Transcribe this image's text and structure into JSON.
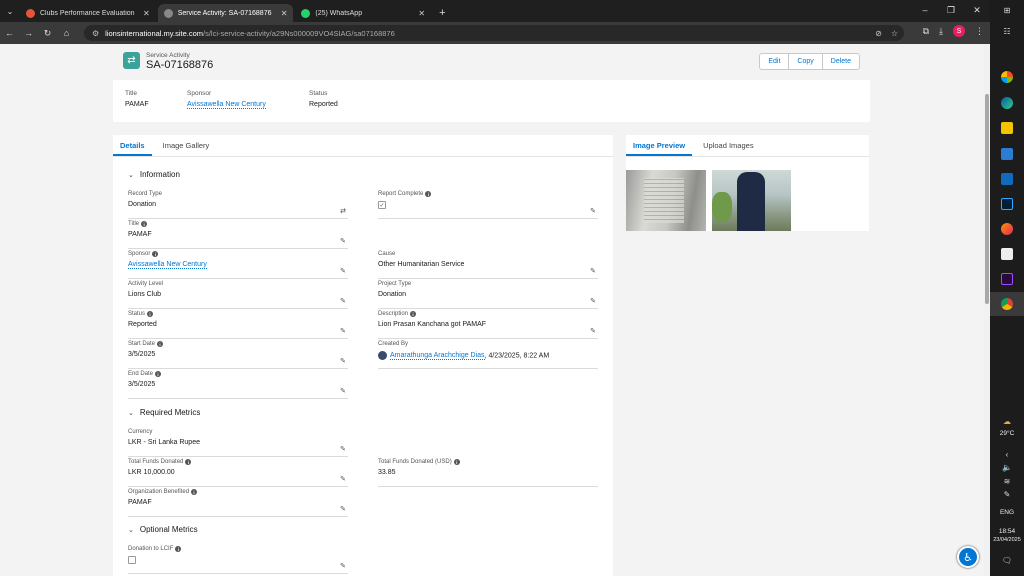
{
  "browser": {
    "tabs": [
      {
        "title": "Clubs Performance Evaluation",
        "favicon_color": "#e6553a",
        "active": false
      },
      {
        "title": "Service Activity: SA-07168876",
        "favicon_color": "#888888",
        "active": true
      },
      {
        "title": "(25) WhatsApp",
        "favicon_color": "#25d366",
        "active": false
      }
    ],
    "url_host": "lionsinternational.my.site.com",
    "url_path": "/s/lci-service-activity/a29Ns000009VO4SIAG/sa07168876",
    "profile_initial": "S"
  },
  "record": {
    "type_label": "Service Activity",
    "name": "SA-07168876",
    "actions": [
      "Edit",
      "Copy",
      "Delete"
    ]
  },
  "highlights": {
    "title_label": "Title",
    "title_value": "PAMAF",
    "sponsor_label": "Sponsor",
    "sponsor_value": "Avissawella New Century",
    "status_label": "Status",
    "status_value": "Reported"
  },
  "detail_tabs": [
    "Details",
    "Image Gallery"
  ],
  "sections": {
    "information": "Information",
    "required_metrics": "Required Metrics",
    "optional_metrics": "Optional Metrics"
  },
  "fields": {
    "record_type": {
      "label": "Record Type",
      "value": "Donation"
    },
    "report_complete": {
      "label": "Report Complete"
    },
    "title": {
      "label": "Title",
      "value": "PAMAF"
    },
    "sponsor": {
      "label": "Sponsor",
      "value": "Avissawella New Century"
    },
    "cause": {
      "label": "Cause",
      "value": "Other Humanitarian Service"
    },
    "activity_level": {
      "label": "Activity Level",
      "value": "Lions Club"
    },
    "project_type": {
      "label": "Project Type",
      "value": "Donation"
    },
    "status": {
      "label": "Status",
      "value": "Reported"
    },
    "description": {
      "label": "Description",
      "value": "Lion Prasan Kanchana got PAMAF"
    },
    "start_date": {
      "label": "Start Date",
      "value": "3/5/2025"
    },
    "created_by": {
      "label": "Created By",
      "user": "Amarathunga Arachchige Dias",
      "timestamp": ", 4/23/2025, 8:22 AM"
    },
    "end_date": {
      "label": "End Date",
      "value": "3/5/2025"
    },
    "currency": {
      "label": "Currency",
      "value": "LKR - Sri Lanka Rupee"
    },
    "total_funds": {
      "label": "Total Funds Donated",
      "value": "LKR 10,000.00"
    },
    "total_funds_usd": {
      "label": "Total Funds Donated (USD)",
      "value": "33.85"
    },
    "org_benefited": {
      "label": "Organization Benefited",
      "value": "PAMAF"
    },
    "donation_lcif": {
      "label": "Donation to LCIF"
    }
  },
  "image_tabs": [
    "Image Preview",
    "Upload Images"
  ],
  "taskbar": {
    "weather": "29°C",
    "language": "ENG",
    "time": "18:54",
    "date": "23/04/2025"
  }
}
